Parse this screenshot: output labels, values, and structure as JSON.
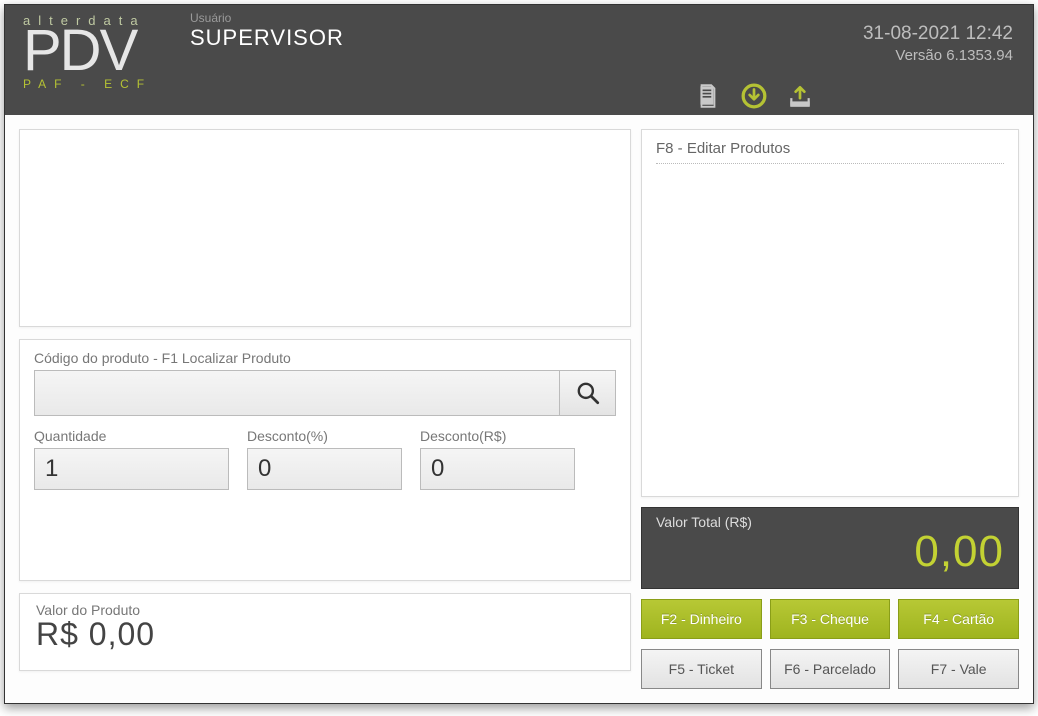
{
  "header": {
    "brand_top": "alterdata",
    "brand_main": "PDV",
    "brand_sub": "PAF - ECF",
    "user_label": "Usuário",
    "user_name": "SUPERVISOR",
    "datetime": "31-08-2021 12:42",
    "version": "Versão 6.1353.94"
  },
  "entry": {
    "product_code_label": "Código do produto - F1 Localizar Produto",
    "product_code_value": "",
    "qty_label": "Quantidade",
    "qty_value": "1",
    "disc_pct_label": "Desconto(%)",
    "disc_pct_value": "0",
    "disc_val_label": "Desconto(R$)",
    "disc_val_value": "0"
  },
  "product_value": {
    "label": "Valor do Produto",
    "value": "R$ 0,00"
  },
  "edit_panel": {
    "title": "F8 - Editar Produtos"
  },
  "total": {
    "label": "Valor Total (R$)",
    "value": "0,00"
  },
  "buttons": {
    "f2": "F2 - Dinheiro",
    "f3": "F3 - Cheque",
    "f4": "F4 - Cartão",
    "f5": "F5 - Ticket",
    "f6": "F6 - Parcelado",
    "f7": "F7 - Vale"
  }
}
